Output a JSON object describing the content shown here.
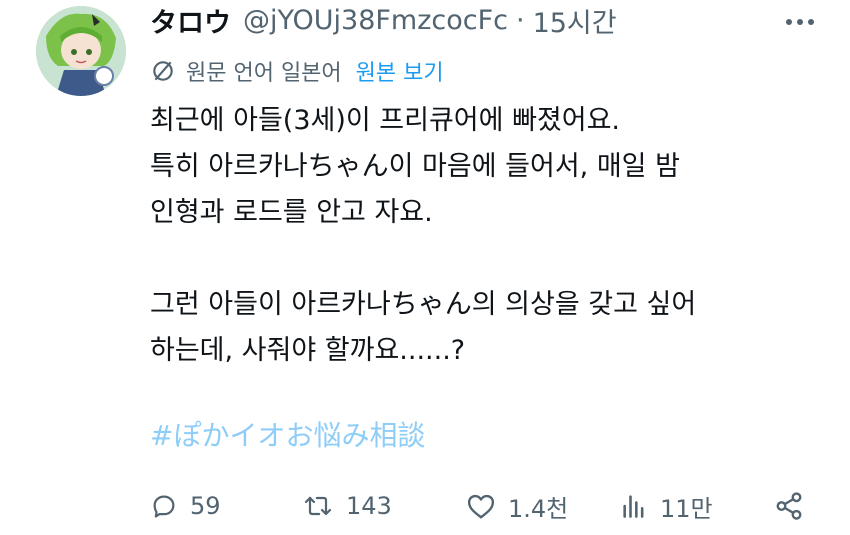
{
  "author": {
    "display_name": "タロウ",
    "handle": "@jYOUj38FmzcocFc",
    "separator": "·",
    "time": "15시간"
  },
  "translation": {
    "label": "원문 언어 일본어",
    "show_original": "원본 보기"
  },
  "body": {
    "lines": [
      "최근에 아들(3세)이 프리큐어에 빠졌어요.",
      "특히 아르카나ちゃん이 마음에 들어서, 매일 밤",
      "인형과 로드를 안고 자요.",
      "그런 아들이 아르카나ちゃん의 의상을 갖고 싶어",
      "하는데, 사줘야 할까요......?"
    ]
  },
  "hashtag": "#ぽかイオお悩み相談",
  "actions": {
    "replies": "59",
    "reposts": "143",
    "likes": "1.4천",
    "views": "11만"
  },
  "icons": {
    "more": "more-dots-icon",
    "translate": "translate-icon",
    "reply": "reply-icon",
    "repost": "repost-icon",
    "like": "heart-icon",
    "views": "views-icon",
    "share": "share-icon"
  },
  "colors": {
    "text": "#0f1419",
    "muted": "#536471",
    "link": "#1d9bf0",
    "hashtag": "#8ecdf8"
  }
}
